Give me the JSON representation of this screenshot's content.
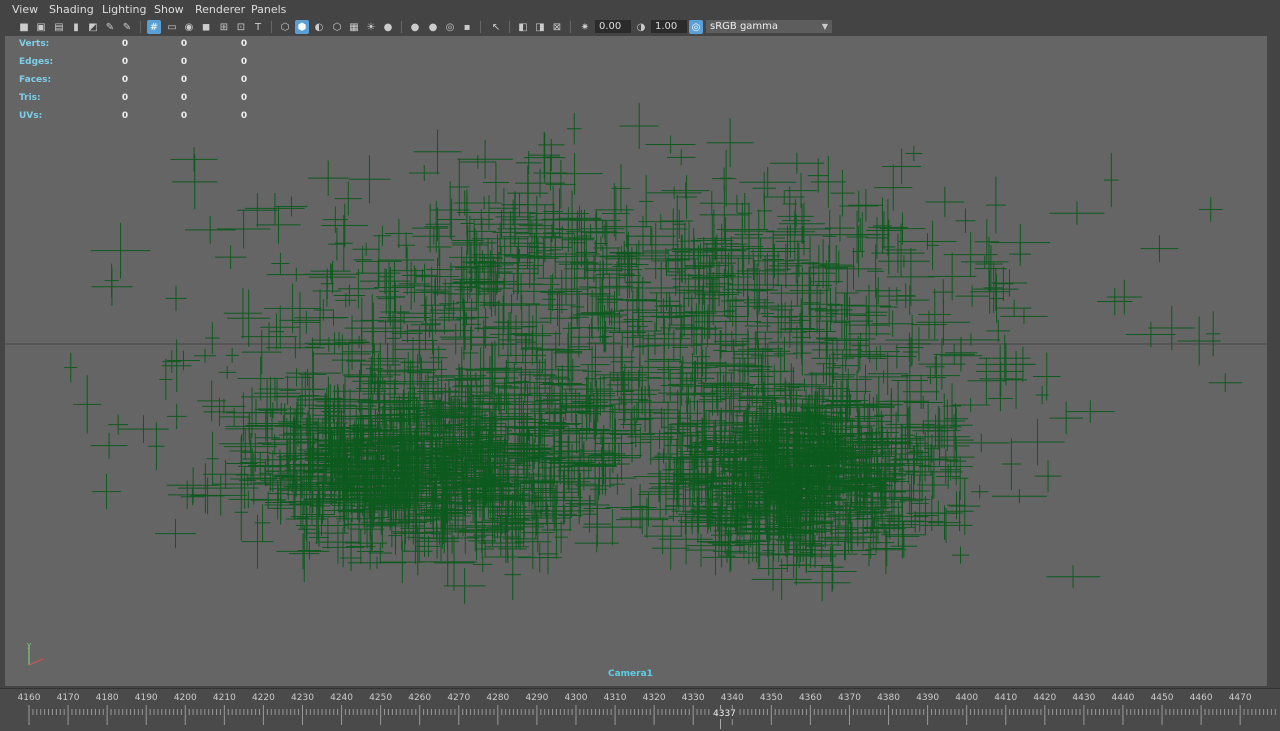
{
  "menu": [
    "View",
    "Shading",
    "Lighting",
    "Show",
    "Renderer",
    "Panels"
  ],
  "toolbar": {
    "exposure_value": "0.00",
    "gamma_value": "1.00",
    "color_space": "sRGB gamma"
  },
  "hud": {
    "rows": [
      {
        "label": "Verts:",
        "values": [
          "0",
          "0",
          "0"
        ]
      },
      {
        "label": "Edges:",
        "values": [
          "0",
          "0",
          "0"
        ]
      },
      {
        "label": "Faces:",
        "values": [
          "0",
          "0",
          "0"
        ]
      },
      {
        "label": "Tris:",
        "values": [
          "0",
          "0",
          "0"
        ]
      },
      {
        "label": "UVs:",
        "values": [
          "0",
          "0",
          "0"
        ]
      }
    ]
  },
  "camera_label": "Camera1",
  "timeline": {
    "labels": [
      "4160",
      "4170",
      "4180",
      "4190",
      "4200",
      "4210",
      "4220",
      "4230",
      "4240",
      "4250",
      "4260",
      "4270",
      "4280",
      "4290",
      "4300",
      "4310",
      "4320",
      "4330",
      "4340",
      "4350",
      "4360",
      "4370",
      "4380",
      "4390",
      "4400",
      "4410",
      "4420",
      "4430",
      "4440",
      "4450",
      "4460",
      "4470"
    ],
    "current_frame": "4337"
  },
  "colors": {
    "viewport_bg": "#656565",
    "points": "#0d5a1e",
    "hud_label": "#7ecfe8"
  }
}
